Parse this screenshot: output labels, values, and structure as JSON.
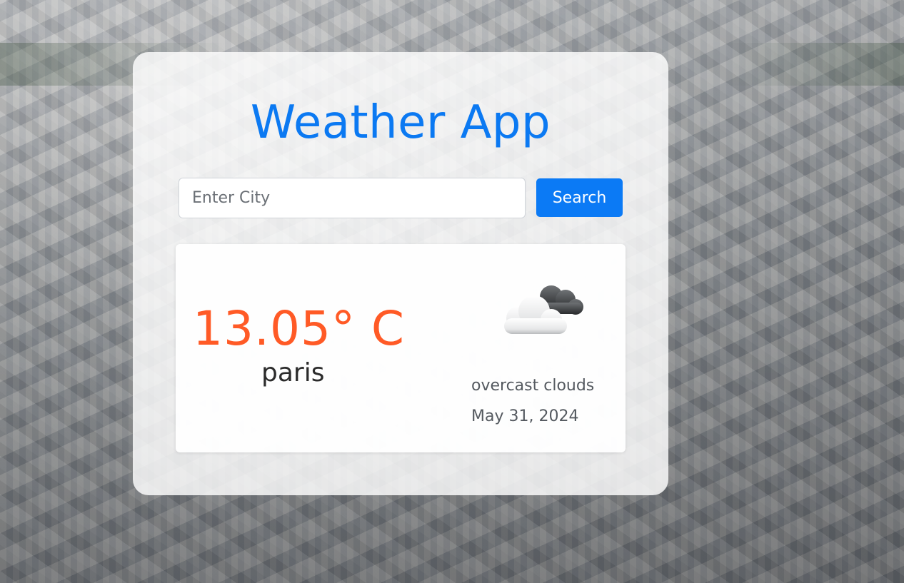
{
  "app": {
    "title": "Weather App"
  },
  "search": {
    "placeholder": "Enter City",
    "value": "",
    "button_label": "Search"
  },
  "weather": {
    "temperature": "13.05° C",
    "city": "paris",
    "icon": "overcast-clouds-icon",
    "description": "overcast clouds",
    "date": "May 31, 2024"
  },
  "colors": {
    "title": "#0b79f2",
    "button": "#0b7af5",
    "temperature": "#ff5a26"
  }
}
